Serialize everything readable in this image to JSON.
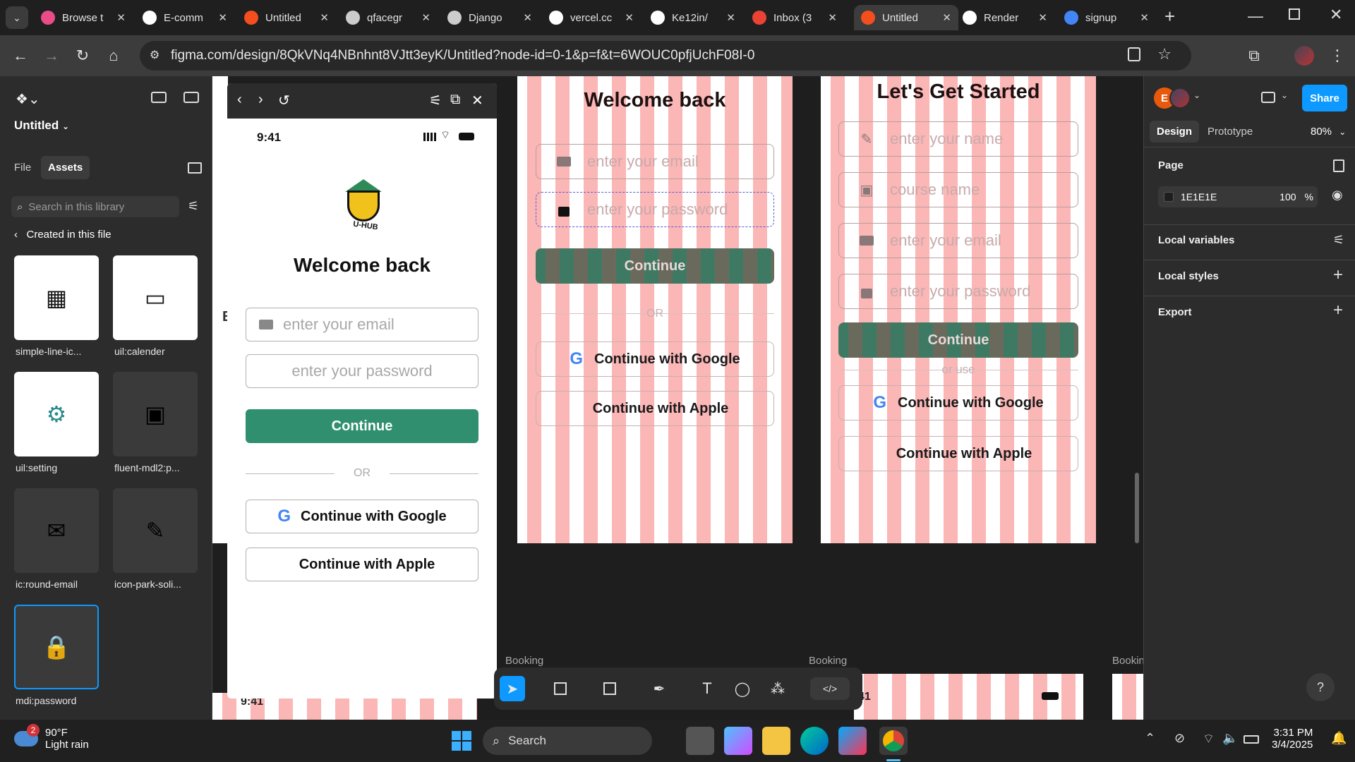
{
  "tabs": [
    {
      "label": "Browse t",
      "icon": "dribbble-icon",
      "color": "#ea4c89"
    },
    {
      "label": "E-comm",
      "icon": "vercel-v0-icon",
      "color": "#ffffff"
    },
    {
      "label": "Untitled",
      "icon": "figma-icon",
      "color": "#f24e1e"
    },
    {
      "label": "qfacegr",
      "icon": "cloud-icon",
      "color": "#cccccc"
    },
    {
      "label": "Django",
      "icon": "django-icon",
      "color": "#cccccc"
    },
    {
      "label": "vercel.cc",
      "icon": "vercel-icon",
      "color": "#ffffff"
    },
    {
      "label": "Ke12in/",
      "icon": "github-icon",
      "color": "#ffffff"
    },
    {
      "label": "Inbox (3",
      "icon": "gmail-icon",
      "color": "#ea4335"
    },
    {
      "label": "Untitled",
      "icon": "figma-icon",
      "color": "#f24e1e",
      "active": true
    },
    {
      "label": "Render",
      "icon": "render-icon",
      "color": "#ffffff"
    },
    {
      "label": "signup",
      "icon": "google-icon",
      "color": "#4285f4"
    }
  ],
  "browser": {
    "url": "figma.com/design/8QkVNq4NBnhnt8VJtt3eyK/Untitled?node-id=0-1&p=f&t=6WOUC0pfjUchF08I-0"
  },
  "left": {
    "file_name": "Untitled",
    "tab_file": "File",
    "tab_assets": "Assets",
    "search_placeholder": "Search in this library",
    "created": "Created in this file",
    "assets": [
      {
        "label": "simple-line-ic...",
        "icon": "calendar-grid-icon",
        "bg": "#ffffff"
      },
      {
        "label": "uil:calender",
        "icon": "calendar-icon",
        "bg": "#ffffff"
      },
      {
        "label": "uil:setting",
        "icon": "settings-icon",
        "bg": "#ffffff"
      },
      {
        "label": "fluent-mdl2:p...",
        "icon": "reading-icon",
        "bg": "#3a3a3a"
      },
      {
        "label": "ic:round-email",
        "icon": "email-icon",
        "bg": "#3a3a3a"
      },
      {
        "label": "icon-park-soli...",
        "icon": "user-edit-icon",
        "bg": "#3a3a3a"
      },
      {
        "label": "mdi:password",
        "icon": "lock-icon",
        "bg": "#3a3a3a"
      }
    ]
  },
  "right": {
    "share": "Share",
    "tab_design": "Design",
    "tab_prototype": "Prototype",
    "zoom": "80%",
    "page": "Page",
    "page_color": "1E1E1E",
    "page_opacity": "100",
    "page_pct": "%",
    "local_variables": "Local variables",
    "local_styles": "Local styles",
    "export": "Export"
  },
  "preview": {
    "time": "9:41",
    "logo_text": "U-HUB",
    "title": "Welcome back",
    "email_placeholder": "enter your email",
    "password_placeholder": "enter your password",
    "continue": "Continue",
    "or": "OR",
    "google": "Continue with Google",
    "apple": "Continue with Apple"
  },
  "frame1": {
    "title": "Welcome back",
    "email_placeholder": "enter your email",
    "password_placeholder": "enter your password",
    "continue": "Continue",
    "or": "OR",
    "google": "Continue with Google",
    "apple": "Continue with Apple"
  },
  "frame2": {
    "title": "Let's Get Started",
    "name_placeholder": "enter your name",
    "course_placeholder": "course name",
    "email_placeholder": "enter your email",
    "password_placeholder": "enter your password",
    "continue": "Continue",
    "or_use": "or use",
    "google": "Continue with Google",
    "apple": "Continue with Apple"
  },
  "canvas": {
    "booking_1": "Booking",
    "booking_2": "Booking",
    "booking_3": "Bookin",
    "partial_time": "41",
    "partial_time2": "9:41",
    "edge_letter": "E"
  },
  "taskbar": {
    "temp": "90°F",
    "weather": "Light rain",
    "badge": "2",
    "search": "Search",
    "time": "3:31 PM",
    "date": "3/4/2025"
  }
}
